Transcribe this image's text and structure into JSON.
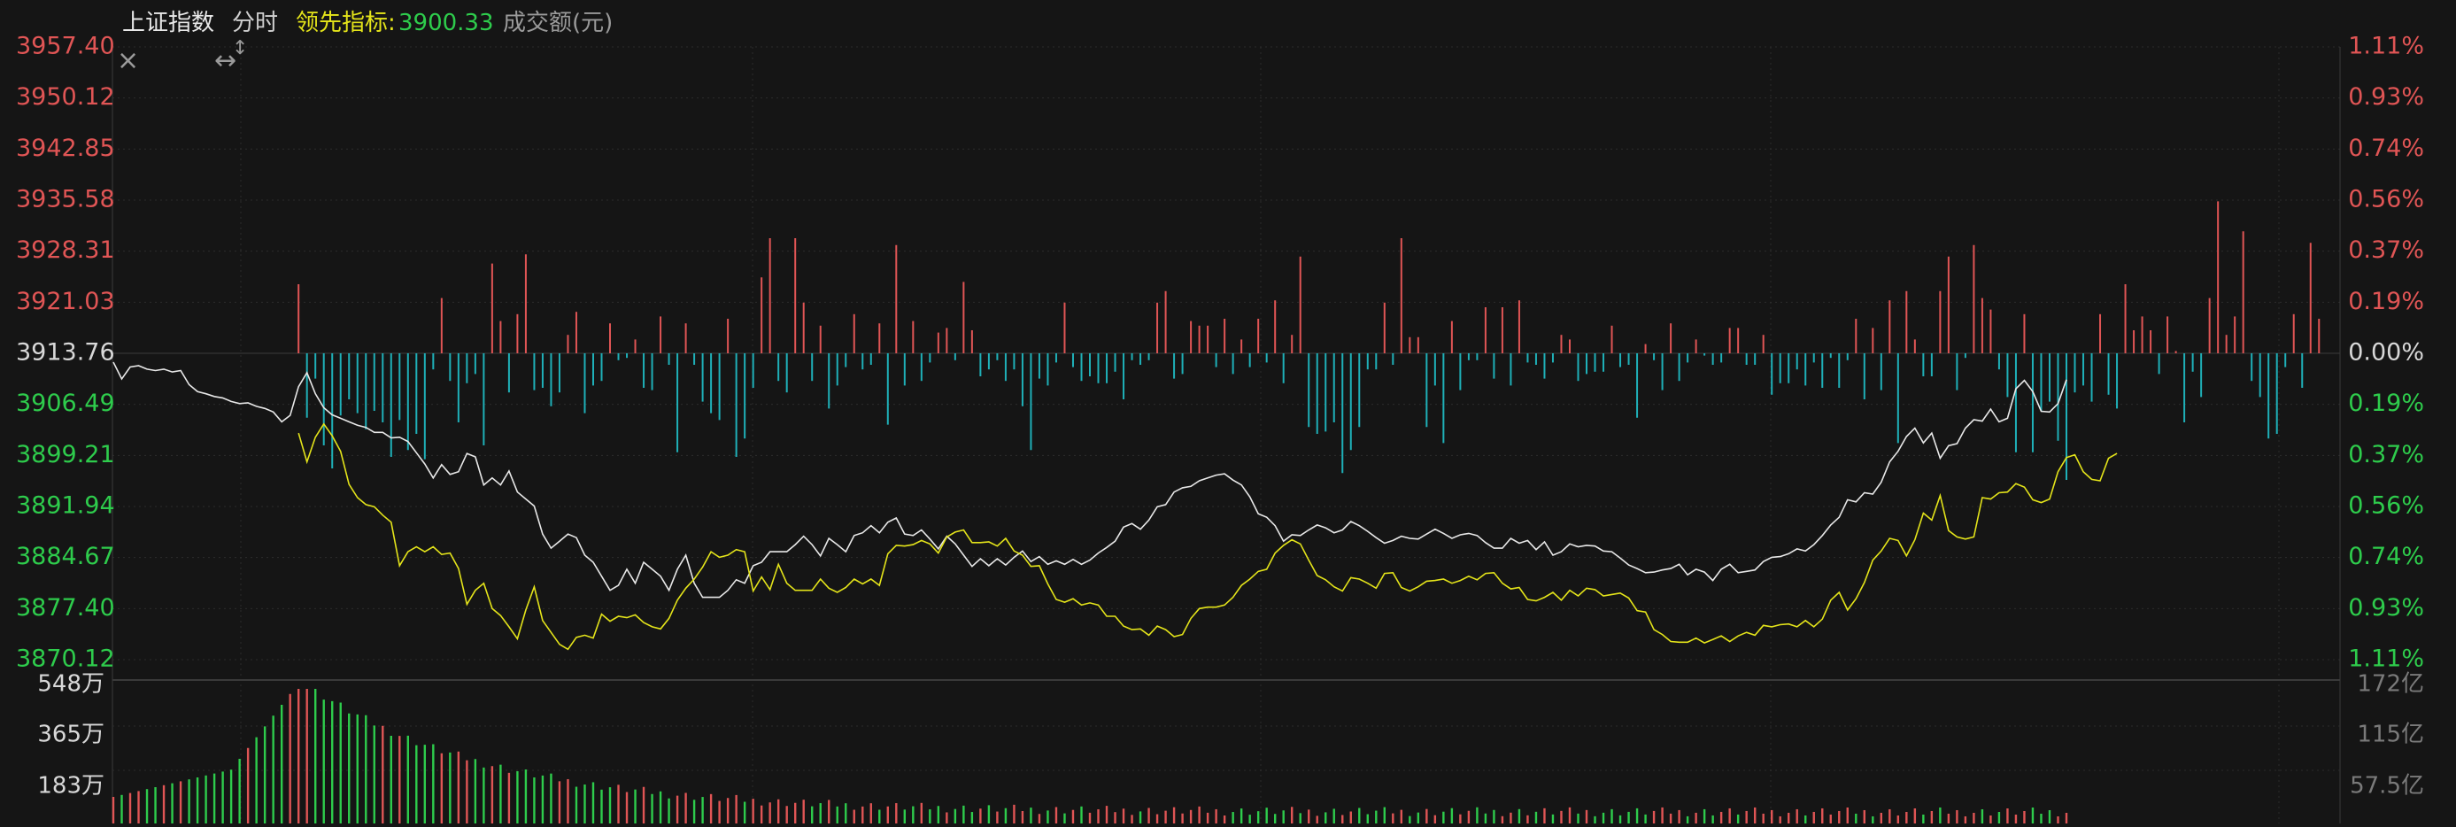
{
  "header": {
    "index_name": "上证指数",
    "timeframe": "分时",
    "leading_label": "领先指标:",
    "leading_value": "3900.33",
    "volume_label": "成交额(元)"
  },
  "icons": {
    "close": "×",
    "resize_horizontal": "↔",
    "resize_vertical": "↕"
  },
  "colors": {
    "up": "#e05555",
    "down": "#1fb0b8",
    "down_text": "#2ecc4c",
    "price_line": "#e8e8e8",
    "leading_line": "#e4e41a",
    "grid": "#2c2c2c",
    "background": "#151515"
  },
  "chart_data": {
    "type": "line",
    "base_price": 3913.76,
    "price_ticks": [
      "3957.40",
      "3950.12",
      "3942.85",
      "3935.58",
      "3928.31",
      "3921.03",
      "3913.76",
      "3906.49",
      "3899.21",
      "3891.94",
      "3884.67",
      "3877.40",
      "3870.12"
    ],
    "percent_ticks": [
      "1.11%",
      "0.93%",
      "0.74%",
      "0.56%",
      "0.37%",
      "0.19%",
      "0.00%",
      "0.19%",
      "0.37%",
      "0.56%",
      "0.74%",
      "0.93%",
      "1.11%"
    ],
    "ylim": [
      3870.12,
      3957.4
    ],
    "volume_ticks_left": [
      "548万",
      "365万",
      "183万"
    ],
    "volume_ticks_right": [
      "172亿",
      "115亿",
      "57.5亿"
    ],
    "series": [
      {
        "name": "上证指数",
        "values": [
          3912.5,
          3910.1,
          3911.8,
          3912.0,
          3911.5,
          3911.3,
          3911.5,
          3911.1,
          3911.3,
          3909.3,
          3908.3,
          3908.0,
          3907.6,
          3907.4,
          3906.9,
          3906.6,
          3906.7,
          3906.2,
          3905.9,
          3905.4,
          3904.0,
          3904.9,
          3909.0,
          3911.0,
          3908.0,
          3906.0,
          3905.0,
          3904.5,
          3904.0,
          3903.5,
          3903.2,
          3902.5,
          3902.5,
          3901.7,
          3901.8,
          3901.2,
          3899.6,
          3898.0,
          3896.0,
          3897.9,
          3896.5,
          3896.9,
          3899.5,
          3899.0,
          3895.0,
          3896.0,
          3895.0,
          3897.0,
          3894.0,
          3893.0,
          3892.0,
          3888.0,
          3886.0,
          3887.0,
          3888.0,
          3887.5,
          3885.0,
          3884.0,
          3882.0,
          3880.0,
          3880.7,
          3883.0,
          3881.0,
          3884.0,
          3883.0,
          3882.0,
          3880.0,
          3883.0,
          3885.0,
          3881.0,
          3879.0,
          3879.0,
          3879.0,
          3880.0,
          3881.5,
          3881.0,
          3883.5,
          3884.0,
          3885.5,
          3885.5,
          3885.5,
          3886.5,
          3887.7,
          3886.5,
          3884.9,
          3887.4,
          3886.5,
          3885.5,
          3887.8,
          3888.2,
          3889.2,
          3888.2,
          3889.7,
          3890.3,
          3888.0,
          3887.8,
          3888.6,
          3887.3,
          3885.9,
          3887.7,
          3886.6,
          3885.0,
          3883.4,
          3884.5,
          3883.5,
          3884.5,
          3883.6,
          3884.7,
          3885.6,
          3884.1,
          3884.8,
          3883.7,
          3884.2,
          3883.7,
          3884.4,
          3883.7,
          3884.3,
          3885.3,
          3886.1,
          3887.0,
          3889.0,
          3889.5,
          3888.7,
          3890.0,
          3891.9,
          3892.2,
          3894.0,
          3894.6,
          3894.8,
          3895.6,
          3896.0,
          3896.4,
          3896.6,
          3895.7,
          3895.0,
          3893.3,
          3890.9,
          3890.4,
          3889.2,
          3887.0,
          3887.9,
          3887.8,
          3888.6,
          3889.3,
          3888.9,
          3888.2,
          3888.6,
          3889.8,
          3889.2,
          3888.4,
          3887.5,
          3886.7,
          3887.1,
          3887.7,
          3887.4,
          3887.3,
          3888.0,
          3888.7,
          3888.1,
          3887.4,
          3887.9,
          3888.1,
          3887.8,
          3886.8,
          3886.0,
          3886.0,
          3887.4,
          3886.7,
          3887.1,
          3885.8,
          3886.9,
          3885.0,
          3885.5,
          3886.6,
          3886.2,
          3886.4,
          3886.3,
          3885.6,
          3885.5,
          3884.6,
          3883.6,
          3883.1,
          3882.5,
          3882.6,
          3882.9,
          3883.1,
          3883.7,
          3882.2,
          3883.0,
          3882.6,
          3881.4,
          3883.0,
          3883.7,
          3882.5,
          3882.7,
          3882.9,
          3884.1,
          3884.7,
          3884.8,
          3885.2,
          3885.9,
          3885.6,
          3886.5,
          3887.8,
          3889.3,
          3890.4,
          3892.9,
          3892.6,
          3893.9,
          3893.7,
          3895.4,
          3898.3,
          3899.8,
          3901.9,
          3903.1,
          3901.0,
          3902.4,
          3898.8,
          3900.6,
          3900.9,
          3903.1,
          3904.3,
          3904.1,
          3905.8,
          3904.0,
          3904.5,
          3908.7,
          3909.9,
          3908.3,
          3905.5,
          3905.4,
          3906.6,
          3910.0
        ],
        "color": "#e8e8e8"
      },
      {
        "name": "领先指标",
        "values": [
          null,
          null,
          null,
          null,
          null,
          null,
          null,
          null,
          null,
          null,
          null,
          null,
          null,
          null,
          null,
          null,
          null,
          null,
          null,
          null,
          null,
          null,
          3902.4,
          3898.3,
          3901.8,
          3903.7,
          3902.0,
          3899.8,
          3895.1,
          3893.2,
          3892.2,
          3891.9,
          3890.7,
          3889.7,
          3883.5,
          3885.5,
          3886.2,
          3885.5,
          3886.2,
          3885.1,
          3885.3,
          3883.1,
          3878.0,
          3880.0,
          3881.0,
          3877.4,
          3876.4,
          3874.8,
          3873.1,
          3877.2,
          3880.5,
          3875.7,
          3874.0,
          3872.3,
          3871.6,
          3873.3,
          3873.6,
          3873.2,
          3876.6,
          3875.6,
          3876.3,
          3876.1,
          3876.5,
          3875.4,
          3874.8,
          3874.5,
          3876.0,
          3878.6,
          3880.3,
          3881.6,
          3883.3,
          3885.5,
          3884.7,
          3885.0,
          3885.8,
          3885.5,
          3879.9,
          3881.9,
          3880.1,
          3883.7,
          3881.0,
          3880.0,
          3880.0,
          3880.0,
          3881.6,
          3880.3,
          3879.7,
          3880.4,
          3881.6,
          3880.9,
          3881.6,
          3880.7,
          3885.2,
          3886.4,
          3886.3,
          3886.5,
          3887.1,
          3886.6,
          3885.3,
          3887.6,
          3888.3,
          3888.6,
          3886.8,
          3886.8,
          3886.9,
          3886.3,
          3887.4,
          3885.6,
          3885.0,
          3883.4,
          3883.5,
          3880.9,
          3878.7,
          3878.3,
          3878.8,
          3877.9,
          3878.2,
          3877.9,
          3876.3,
          3876.3,
          3874.9,
          3874.4,
          3874.5,
          3873.6,
          3874.9,
          3874.4,
          3873.4,
          3873.7,
          3876.0,
          3877.4,
          3877.6,
          3877.6,
          3877.9,
          3879.0,
          3880.7,
          3881.6,
          3882.7,
          3883.0,
          3885.3,
          3886.4,
          3887.2,
          3886.6,
          3884.3,
          3882.1,
          3881.5,
          3880.5,
          3879.9,
          3881.8,
          3881.6,
          3881.0,
          3880.3,
          3882.4,
          3882.5,
          3880.4,
          3879.9,
          3880.5,
          3881.3,
          3881.4,
          3881.6,
          3881.0,
          3881.4,
          3882.0,
          3881.5,
          3882.4,
          3882.5,
          3881.0,
          3880.2,
          3880.4,
          3878.7,
          3878.5,
          3879.0,
          3879.7,
          3878.6,
          3880.0,
          3879.2,
          3880.3,
          3880.1,
          3879.2,
          3879.4,
          3879.6,
          3878.9,
          3877.1,
          3876.9,
          3874.4,
          3873.7,
          3872.7,
          3872.6,
          3872.6,
          3873.2,
          3872.5,
          3873.0,
          3873.5,
          3872.7,
          3873.5,
          3874.0,
          3873.6,
          3875.0,
          3874.8,
          3875.1,
          3875.2,
          3874.8,
          3875.7,
          3874.8,
          3875.9,
          3878.6,
          3879.7,
          3877.2,
          3878.8,
          3881.1,
          3884.3,
          3885.6,
          3887.4,
          3887.1,
          3884.9,
          3887.2,
          3891.0,
          3890.0,
          3893.5,
          3888.5,
          3887.6,
          3887.3,
          3887.6,
          3893.2,
          3893.0,
          3893.9,
          3894.0,
          3895.2,
          3894.7,
          3892.9,
          3892.5,
          3893.0,
          3896.9,
          3898.9,
          3899.3,
          3896.9,
          3895.8,
          3895.6,
          3898.8,
          3899.5
        ],
        "color": "#e4e41a"
      }
    ],
    "leading_diff": [
      0,
      0,
      0,
      0,
      0,
      0,
      0,
      0,
      0,
      0,
      0,
      0,
      0,
      0,
      0,
      0,
      0,
      0,
      0,
      0,
      0,
      0,
      3.0,
      -2.8,
      -1.1,
      -4.0,
      -5.0,
      -2.7,
      -2.0,
      -2.6,
      -3.3,
      -2.5,
      -3.0,
      -4.5,
      -2.9,
      -4.2,
      -3.5,
      -4.6,
      -0.7,
      2.4,
      -1.2,
      -3.0,
      -1.3,
      -0.9,
      -4.0,
      3.9,
      1.4,
      -1.7,
      1.7,
      4.3,
      -1.6,
      -1.5,
      -2.3,
      -1.7,
      0.8,
      1.8,
      -2.6,
      -1.4,
      -1.2,
      1.3,
      -0.3,
      -0.2,
      0.6,
      -1.5,
      -1.6,
      1.6,
      -0.5,
      -4.3,
      1.3,
      -0.5,
      -2.1,
      -2.6,
      -2.9,
      1.5,
      -4.5,
      -3.7,
      -1.5,
      3.3,
      5.0,
      -1.2,
      -1.7,
      5.0,
      2.2,
      -1.2,
      1.2,
      -2.4,
      -1.4,
      -0.6,
      1.7,
      -0.7,
      -0.5,
      1.3,
      -3.1,
      4.7,
      -1.4,
      1.4,
      -1.2,
      -0.4,
      0.9,
      1.1,
      -0.3,
      3.1,
      1.0,
      -1.0,
      -0.7,
      -0.3,
      -1.2,
      -0.7,
      -2.3,
      -4.2,
      -1.1,
      -1.4,
      -0.4,
      2.2,
      -0.6,
      -1.2,
      -1.0,
      -1.3,
      -1.3,
      -0.8,
      -2.0,
      -0.3,
      -0.5,
      -0.3,
      2.2,
      2.7,
      -1.1,
      -0.9,
      1.4,
      1.2,
      1.2,
      -0.6,
      1.5,
      -0.9,
      0.6,
      -0.6,
      1.5,
      -0.4,
      2.3,
      -1.3,
      0.8,
      4.2,
      -3.2,
      -3.5,
      -3.4,
      -3.0,
      -5.2,
      -4.2,
      -3.2,
      -0.7,
      -0.7,
      2.2,
      -0.5,
      5.0,
      0.7,
      0.7,
      -3.2,
      -1.4,
      -3.9,
      1.4,
      -1.6,
      -0.3,
      -0.3,
      2.0,
      -1.1,
      2.0,
      -1.4,
      2.3,
      -0.4,
      -0.5,
      -1.1,
      -0.4,
      0.8,
      0.6,
      -1.2,
      -0.9,
      -0.8,
      -0.8,
      1.2,
      -0.6,
      -0.5,
      -2.8,
      0.4,
      -0.3,
      -1.6,
      1.3,
      -1.2,
      -0.4,
      0.6,
      -0.1,
      -0.5,
      -0.4,
      1.1,
      1.1,
      -0.5,
      -0.5,
      0.8,
      -1.8,
      -1.3,
      -1.3,
      -0.7,
      -1.4,
      -0.4,
      -1.5,
      -0.2,
      -1.5,
      -0.3,
      1.5,
      -2.0,
      1.1,
      -1.6,
      2.3,
      -3.9,
      2.7,
      0.6,
      -1.0,
      -1.0,
      2.7,
      4.2,
      -1.6,
      -0.2,
      4.7,
      2.4,
      1.9,
      -0.7,
      -1.9,
      -4.3,
      1.7,
      -4.3,
      -2.5,
      -2.1,
      -3.8,
      -5.5,
      -1.7,
      -1.4,
      -2.1,
      1.7,
      -1.8,
      -2.4,
      3.0,
      1.0,
      1.6,
      1.0,
      -0.9,
      1.6,
      0.1,
      -3.0,
      -0.8,
      -1.9,
      2.4,
      6.6,
      0.8,
      1.6,
      5.3,
      -1.2,
      -1.9,
      -3.7,
      -3.5,
      -0.6,
      1.7,
      -1.5,
      4.8,
      1.5
    ]
  }
}
